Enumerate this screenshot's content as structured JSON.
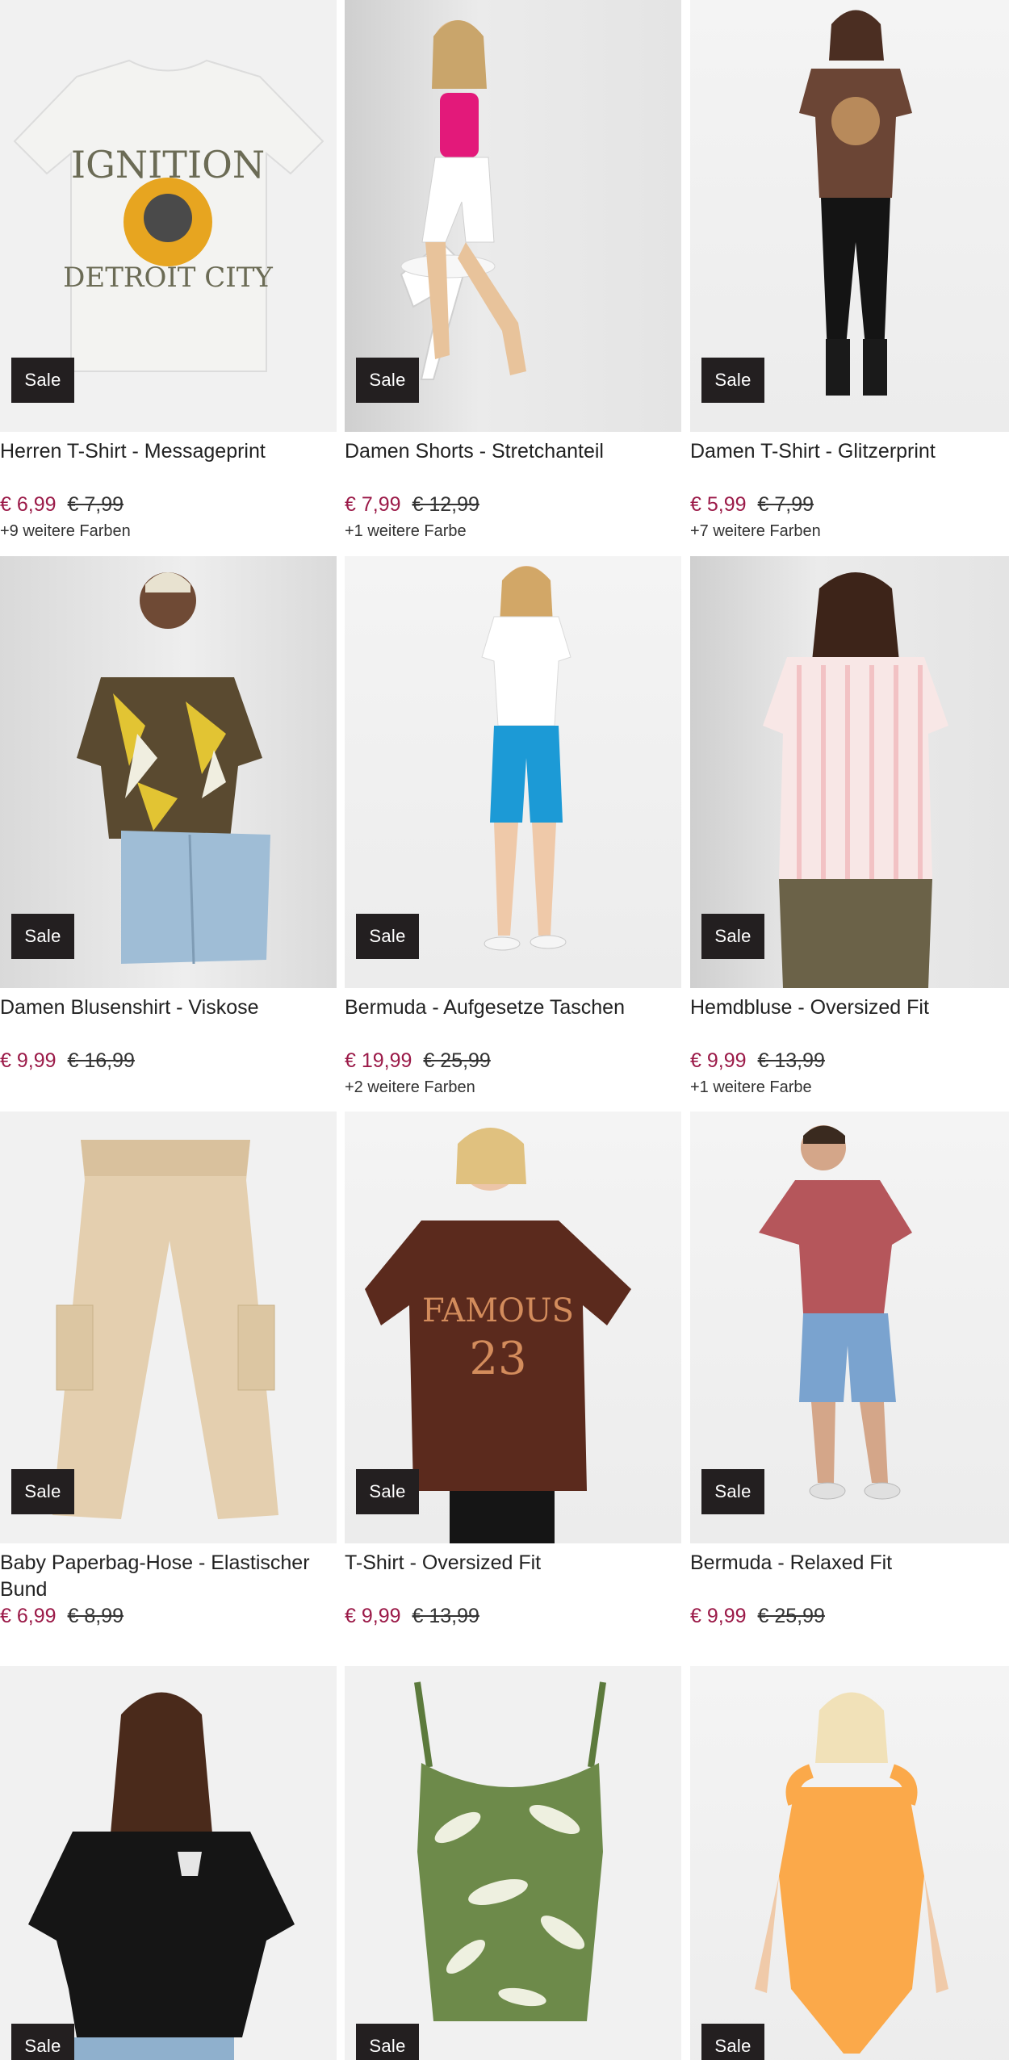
{
  "brand": {
    "sale_color": "#9b1a48",
    "badge_color": "#231f20"
  },
  "products": [
    {
      "name": "Herren T-Shirt - Messageprint",
      "price": "€ 6,99",
      "old_price": "€ 7,99",
      "colors": "+9 weitere Farben",
      "badge": "Sale",
      "image_icon": "white-graphic-tshirt"
    },
    {
      "name": "Damen Shorts - Stretchanteil",
      "price": "€ 7,99",
      "old_price": "€ 12,99",
      "colors": "+1 weitere Farbe",
      "badge": "Sale",
      "image_icon": "model-white-shorts"
    },
    {
      "name": "Damen T-Shirt - Glitzerprint",
      "price": "€ 5,99",
      "old_price": "€ 7,99",
      "colors": "+7 weitere Farben",
      "badge": "Sale",
      "image_icon": "model-brown-tshirt"
    },
    {
      "name": "Damen Blusenshirt - Viskose",
      "price": "€ 9,99",
      "old_price": "€ 16,99",
      "colors": "",
      "badge": "Sale",
      "image_icon": "model-printed-blouse"
    },
    {
      "name": "Bermuda - Aufgesetze Taschen",
      "price": "€ 19,99",
      "old_price": "€ 25,99",
      "colors": "+2 weitere Farben",
      "badge": "Sale",
      "image_icon": "model-blue-bermuda"
    },
    {
      "name": "Hemdbluse - Oversized Fit",
      "price": "€ 9,99",
      "old_price": "€ 13,99",
      "colors": "+1 weitere Farbe",
      "badge": "Sale",
      "image_icon": "model-striped-shirt"
    },
    {
      "name": "Baby Paperbag-Hose - Elastischer Bund",
      "price": "€ 6,99",
      "old_price": "€ 8,99",
      "colors": "",
      "badge": "Sale",
      "image_icon": "beige-cargo-pants"
    },
    {
      "name": "T-Shirt - Oversized Fit",
      "price": "€ 9,99",
      "old_price": "€ 13,99",
      "colors": "",
      "badge": "Sale",
      "image_icon": "model-famous-tshirt"
    },
    {
      "name": "Bermuda - Relaxed Fit",
      "price": "€ 9,99",
      "old_price": "€ 25,99",
      "colors": "",
      "badge": "Sale",
      "image_icon": "model-denim-bermuda"
    },
    {
      "name": "",
      "price": "",
      "old_price": "",
      "colors": "",
      "badge": "Sale",
      "image_icon": "model-black-tshirt"
    },
    {
      "name": "",
      "price": "",
      "old_price": "",
      "colors": "",
      "badge": "Sale",
      "image_icon": "green-leaf-swimsuit"
    },
    {
      "name": "",
      "price": "",
      "old_price": "",
      "colors": "",
      "badge": "Sale",
      "image_icon": "model-orange-swimsuit"
    }
  ]
}
